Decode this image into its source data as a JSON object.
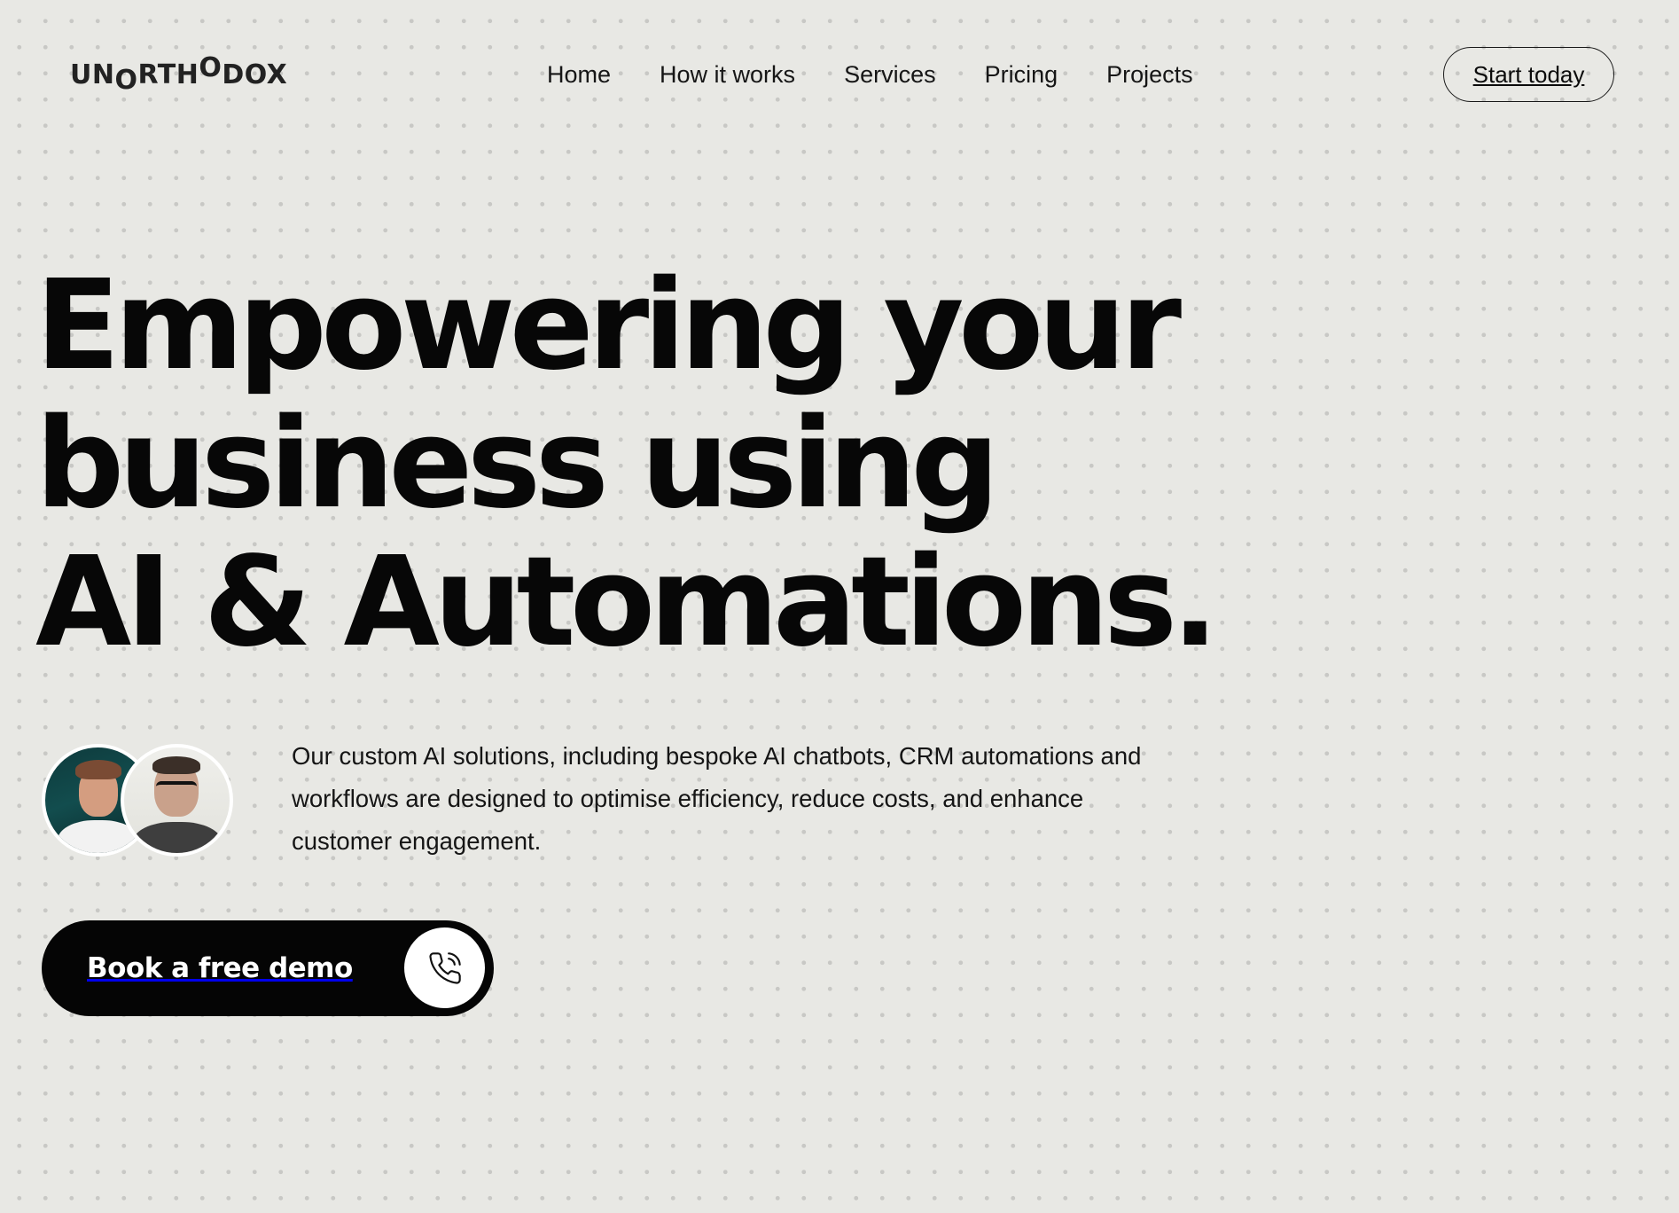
{
  "brand": {
    "logo_parts": [
      {
        "text": "UN",
        "pos": "base"
      },
      {
        "text": "O",
        "pos": "low"
      },
      {
        "text": "RTH",
        "pos": "base"
      },
      {
        "text": "O",
        "pos": "high"
      },
      {
        "text": "DOX",
        "pos": "base"
      }
    ]
  },
  "nav": {
    "items": [
      {
        "label": "Home"
      },
      {
        "label": "How it works"
      },
      {
        "label": "Services"
      },
      {
        "label": "Pricing"
      },
      {
        "label": "Projects"
      }
    ]
  },
  "header": {
    "cta_label": "Start today"
  },
  "hero": {
    "title_lines": [
      "Empowering your",
      "business using",
      "AI & Automations."
    ],
    "description": "Our custom AI solutions, including bespoke AI chatbots, CRM automations and workflows are designed to optimise efficiency, reduce costs, and enhance customer engagement.",
    "cta_label": "Book a free demo",
    "cta_icon": "phone-ringing-icon"
  },
  "colors": {
    "background": "#e8e8e4",
    "text": "#070707",
    "cta_bg": "#050505",
    "cta_text": "#ffffff"
  }
}
